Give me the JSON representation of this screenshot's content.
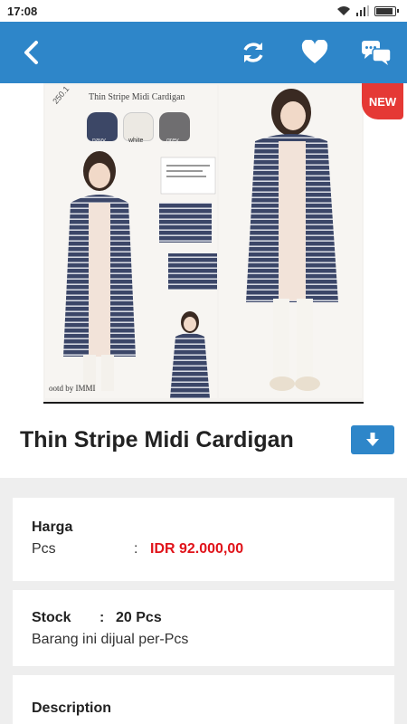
{
  "status_bar": {
    "time": "17:08"
  },
  "product": {
    "title": "Thin Stripe Midi Cardigan",
    "image_title": "Thin Stripe Midi Cardigan",
    "image_sku": "250.1",
    "image_caption": "ootd by IMMI",
    "swatches": [
      {
        "label": "navy",
        "color": "#3c4766"
      },
      {
        "label": "white",
        "color": "#ece9e3"
      },
      {
        "label": "grey",
        "color": "#6f6e70"
      }
    ],
    "badge": "NEW"
  },
  "price": {
    "heading": "Harga",
    "unit": "Pcs",
    "separator": ":",
    "value": "IDR 92.000,00"
  },
  "stock": {
    "label": "Stock",
    "separator": ":",
    "value": "20 Pcs",
    "note": "Barang ini dijual per-Pcs"
  },
  "description": {
    "heading": "Description"
  },
  "colors": {
    "primary": "#2e86c9",
    "price": "#e0131a",
    "badge": "#e53935"
  }
}
